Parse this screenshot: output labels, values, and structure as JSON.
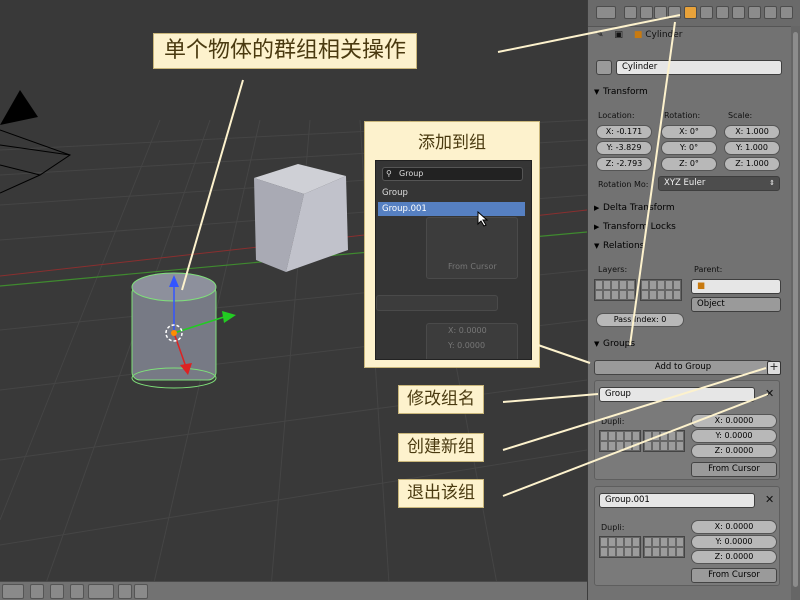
{
  "viewport": {
    "colors": {
      "background": "#393939",
      "grid": "#454545",
      "x_axis": "#8a2f2f",
      "y_axis": "#3f8a2f"
    }
  },
  "properties": {
    "breadcrumb": {
      "object": "Cylinder"
    },
    "object_name": "Cylinder",
    "transform": {
      "header": "Transform",
      "location_label": "Location:",
      "rotation_label": "Rotation:",
      "scale_label": "Scale:",
      "location": [
        "X: -0.171",
        "Y: -3.829",
        "Z: -2.793"
      ],
      "rotation": [
        "X: 0°",
        "Y: 0°",
        "Z: 0°"
      ],
      "scale": [
        "X: 1.000",
        "Y: 1.000",
        "Z: 1.000"
      ],
      "rotation_mode_label": "Rotation Mo:",
      "rotation_mode_value": "XYZ Euler"
    },
    "delta_transform_header": "Delta Transform",
    "transform_locks_header": "Transform Locks",
    "relations": {
      "header": "Relations",
      "layers_label": "Layers:",
      "parent_label": "Parent:",
      "parent_type": "Object",
      "pass_index": "Pass Index: 0"
    },
    "groups": {
      "header": "Groups",
      "add_button": "Add to Group",
      "items": [
        {
          "name": "Group",
          "dupli_label": "Dupli:",
          "offsets": [
            "X: 0.0000",
            "Y: 0.0000",
            "Z: 0.0000"
          ],
          "from_cursor": "From Cursor"
        },
        {
          "name": "Group.001",
          "dupli_label": "Dupli:",
          "offsets": [
            "X: 0.0000",
            "Y: 0.0000",
            "Z: 0.0000"
          ],
          "from_cursor": "From Cursor"
        }
      ]
    }
  },
  "popup": {
    "title": "添加到组",
    "search_text": "Group",
    "options": [
      "Group",
      "Group.001"
    ],
    "selected": "Group.001",
    "ghost_labels": [
      "X: 0.0000",
      "Y: 0.0000",
      "From Cursor"
    ]
  },
  "callouts": {
    "main": "单个物体的群组相关操作",
    "rename": "修改组名",
    "create": "创建新组",
    "leave": "退出该组"
  },
  "colors": {
    "callout_bg": "#fdf2cd",
    "callout_text": "#4a3a10",
    "active_tab": "#e8a23a",
    "selection": "#5680c2"
  }
}
